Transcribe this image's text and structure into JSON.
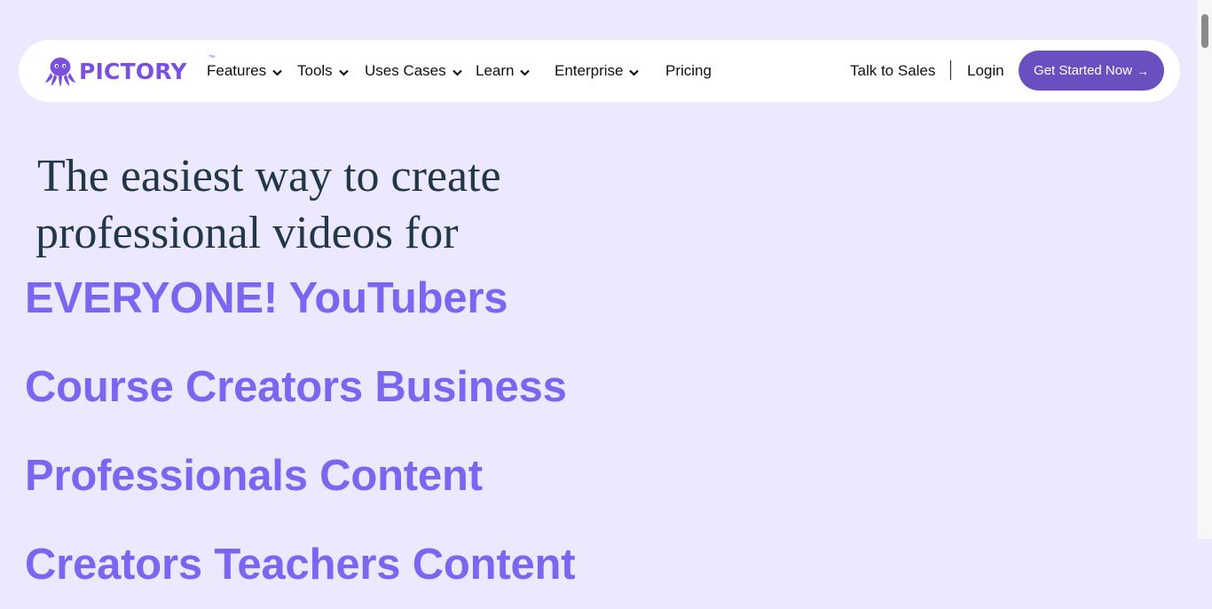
{
  "colors": {
    "page_background": "#ece8fd",
    "nav_background": "#ffffff",
    "brand_purple": "#7b4fe0",
    "cta_background": "#6a4fc1",
    "headline_text": "#22384a",
    "rotator_text": "#7b66f2"
  },
  "logo": {
    "text": "PICTORY",
    "trademark": "™",
    "icon": "octopus-icon"
  },
  "nav": {
    "items": [
      {
        "label": "Features",
        "icon": "chevron-down-icon"
      },
      {
        "label": "Tools",
        "icon": "chevron-down-icon"
      },
      {
        "label": "Uses Cases",
        "icon": "chevron-down-icon"
      },
      {
        "label": "Learn",
        "icon": "chevron-down-icon"
      },
      {
        "label": "Enterprise",
        "icon": "chevron-down-icon"
      },
      {
        "label": "Pricing"
      }
    ],
    "talk_to_sales": "Talk to Sales",
    "login": "Login",
    "cta_label": "Get Started Now",
    "cta_icon": "arrow-right-icon"
  },
  "hero": {
    "headline_line1": "The easiest way to create",
    "headline_line2": "professional videos for",
    "rotator_lines": [
      "EVERYONE! YouTubers",
      "Course Creators Business",
      "Professionals Content",
      "Creators Teachers Content"
    ]
  }
}
